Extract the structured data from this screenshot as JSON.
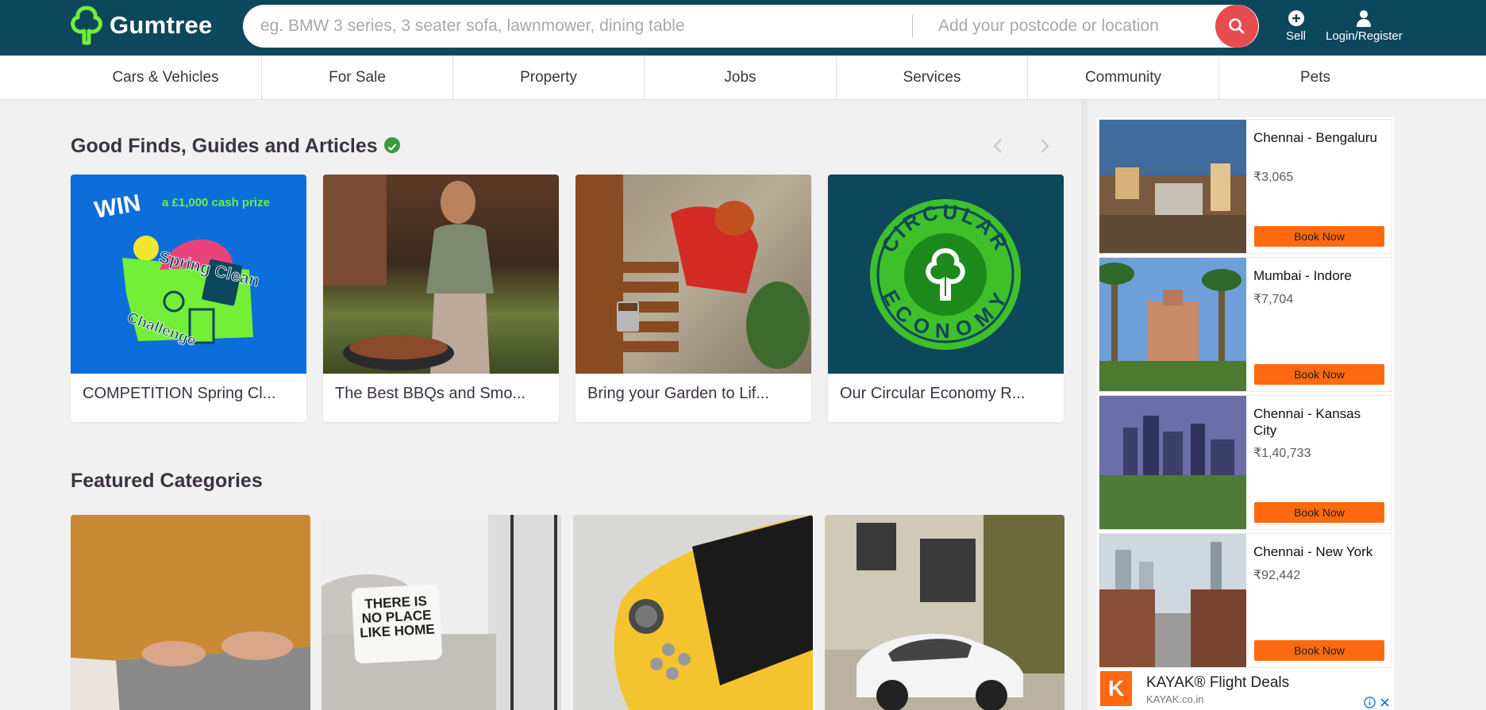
{
  "header": {
    "logo_text": "Gumtree",
    "search_placeholder": "eg. BMW 3 series, 3 seater sofa, lawnmower, dining table",
    "location_placeholder": "Add your postcode or location",
    "sell_label": "Sell",
    "login_label": "Login/Register"
  },
  "nav": {
    "items": [
      "Cars & Vehicles",
      "For Sale",
      "Property",
      "Jobs",
      "Services",
      "Community",
      "Pets"
    ]
  },
  "good_finds": {
    "title": "Good Finds, Guides and Articles",
    "cards": [
      {
        "caption": "COMPETITION Spring Cl...",
        "art_text_1": "WIN",
        "art_text_2": "a £1,000 cash prize",
        "art_text_3": "Spring Clean",
        "art_text_4": "Challenge"
      },
      {
        "caption": "The Best BBQs and Smo..."
      },
      {
        "caption": "Bring your Garden to Lif..."
      },
      {
        "caption": "Our Circular Economy R...",
        "art_text_1": "CIRCULAR",
        "art_text_2": "ECONOMY"
      }
    ]
  },
  "featured": {
    "title": "Featured Categories",
    "cushion_text": "THERE IS NO PLACE LIKE HOME"
  },
  "ad": {
    "items": [
      {
        "title": "Chennai - Bengaluru",
        "price": "₹3,065",
        "button": "Book Now"
      },
      {
        "title": "Mumbai - Indore",
        "price": "₹7,704",
        "button": "Book Now"
      },
      {
        "title": "Chennai - Kansas City",
        "price": "₹1,40,733",
        "button": "Book Now"
      },
      {
        "title": "Chennai - New York",
        "price": "₹92,442",
        "button": "Book Now"
      }
    ],
    "kayak_logo": "K",
    "kayak_title": "KAYAK® Flight Deals",
    "kayak_url": "KAYAK.co.in"
  },
  "colors": {
    "header_bg": "#0d475c",
    "brand_green": "#72ef36",
    "search_button": "#e84c4f",
    "book_button": "#ff6910"
  }
}
